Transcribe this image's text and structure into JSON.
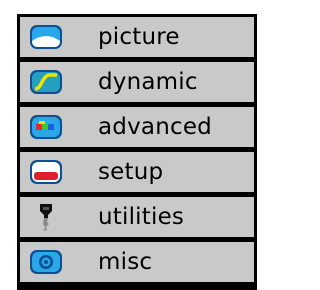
{
  "menu": {
    "items": [
      {
        "label": "picture",
        "icon": "picture-icon"
      },
      {
        "label": "dynamic",
        "icon": "dynamic-icon"
      },
      {
        "label": "advanced",
        "icon": "advanced-icon"
      },
      {
        "label": "setup",
        "icon": "setup-icon"
      },
      {
        "label": "utilities",
        "icon": "utilities-icon"
      },
      {
        "label": "misc",
        "icon": "misc-icon"
      }
    ]
  },
  "colors": {
    "row_background": "#c9c9c9",
    "border": "#000000",
    "icon_blue": "#1aa0e6",
    "icon_dark_blue": "#0b5fa8"
  }
}
